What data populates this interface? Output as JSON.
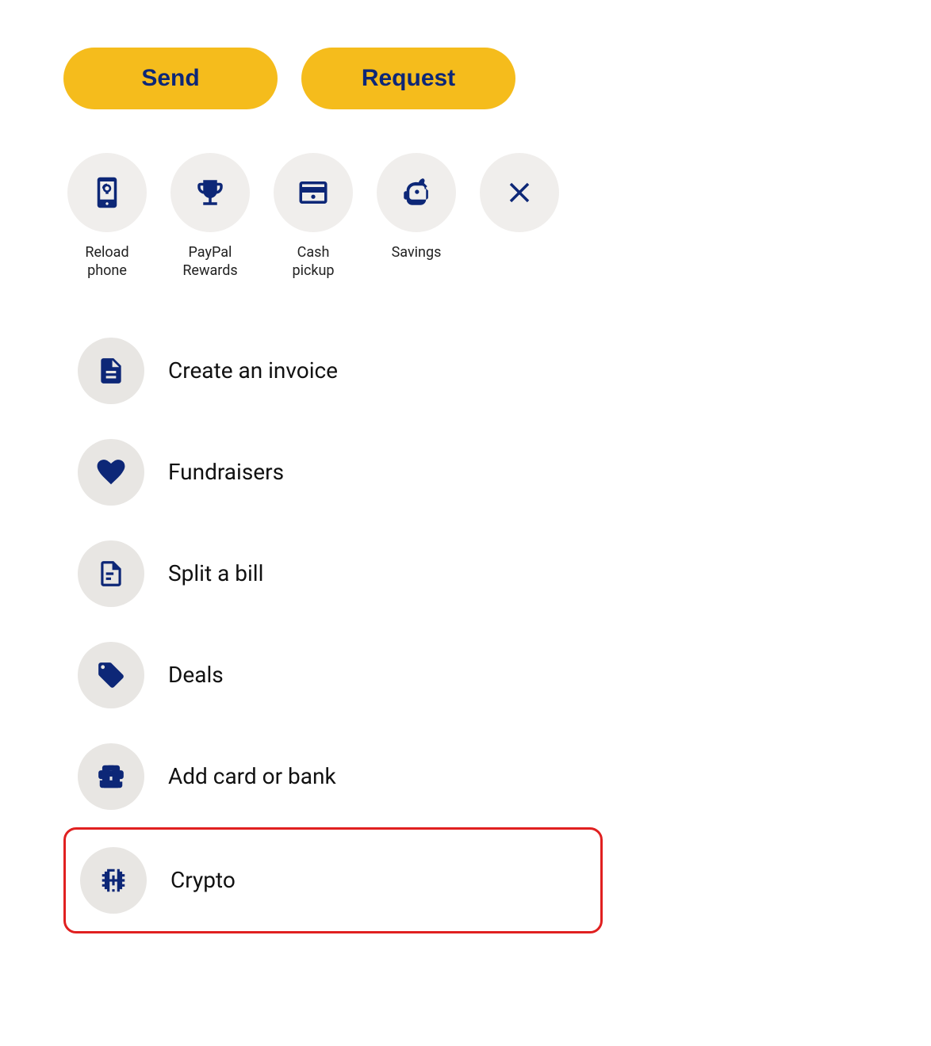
{
  "buttons": {
    "send": "Send",
    "request": "Request"
  },
  "quick_actions": [
    {
      "id": "reload-phone",
      "label": "Reload\nphone",
      "icon": "reload-phone-icon"
    },
    {
      "id": "paypal-rewards",
      "label": "PayPal\nRewards",
      "icon": "trophy-icon"
    },
    {
      "id": "cash-pickup",
      "label": "Cash\npickup",
      "icon": "cash-pickup-icon"
    },
    {
      "id": "savings",
      "label": "Savings",
      "icon": "savings-icon"
    },
    {
      "id": "close",
      "label": "",
      "icon": "close-icon"
    }
  ],
  "list_items": [
    {
      "id": "create-invoice",
      "label": "Create an invoice",
      "icon": "invoice-icon"
    },
    {
      "id": "fundraisers",
      "label": "Fundraisers",
      "icon": "fundraisers-icon"
    },
    {
      "id": "split-bill",
      "label": "Split a bill",
      "icon": "split-bill-icon"
    },
    {
      "id": "deals",
      "label": "Deals",
      "icon": "deals-icon"
    },
    {
      "id": "add-card-bank",
      "label": "Add card or bank",
      "icon": "add-card-icon"
    },
    {
      "id": "crypto",
      "label": "Crypto",
      "icon": "crypto-icon",
      "highlighted": true
    }
  ],
  "colors": {
    "brand_yellow": "#F5BC1C",
    "brand_navy": "#0d2777",
    "icon_bg": "#e8e6e3",
    "highlight_border": "#e02020"
  }
}
